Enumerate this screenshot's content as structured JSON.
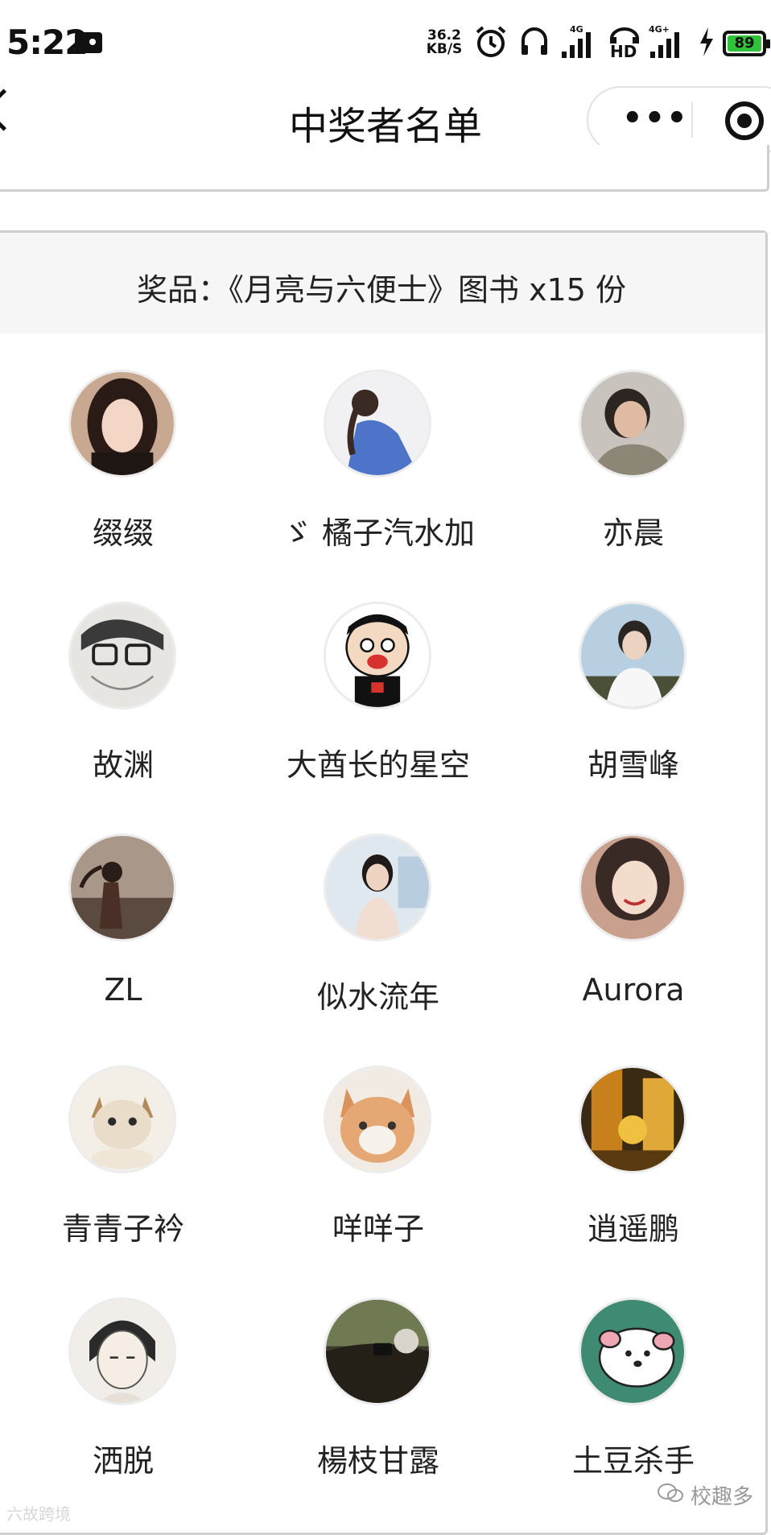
{
  "status_bar": {
    "time": "5:22",
    "net_speed_value": "36.2",
    "net_speed_unit": "KB/S",
    "net_4g": "4G",
    "net_4g_plus": "4G+",
    "hd": "HD",
    "battery": "89",
    "icons": [
      "image-notification-icon",
      "alarm-icon",
      "headphones-icon",
      "signal-icon",
      "hd-call-icon",
      "signal-icon",
      "charging-icon",
      "battery-icon"
    ]
  },
  "nav": {
    "title": "中奖者名单",
    "back_icon": "chevron-left-icon",
    "more_icon": "more-dots-icon",
    "close_icon": "target-close-icon"
  },
  "prize": {
    "label": "奖品：《月亮与六便士》图书 x15 份"
  },
  "winners": [
    {
      "name": "缀缀",
      "avatar": "avatar-girl-portrait"
    },
    {
      "name": "ゞ 橘子汽水加",
      "avatar": "avatar-girl-blue-jacket"
    },
    {
      "name": "亦晨",
      "avatar": "avatar-boy-on-phone"
    },
    {
      "name": "故渊",
      "avatar": "avatar-anime-glasses"
    },
    {
      "name": "大酋长的星空",
      "avatar": "avatar-cartoon-hug-boy"
    },
    {
      "name": "胡雪峰",
      "avatar": "avatar-boy-white-shirt"
    },
    {
      "name": "ZL",
      "avatar": "avatar-girl-windy"
    },
    {
      "name": "似水流年",
      "avatar": "avatar-girl-outdoor"
    },
    {
      "name": "Aurora",
      "avatar": "avatar-smiling-girl"
    },
    {
      "name": "青青子衿",
      "avatar": "avatar-kitten"
    },
    {
      "name": "咩咩子",
      "avatar": "avatar-drawn-cat"
    },
    {
      "name": "逍遥鹏",
      "avatar": "avatar-street-night"
    },
    {
      "name": "洒脱",
      "avatar": "avatar-anime-boy"
    },
    {
      "name": "楊枝甘露",
      "avatar": "avatar-car-photo"
    },
    {
      "name": "土豆杀手",
      "avatar": "avatar-white-dog"
    }
  ],
  "watermark_left": "六故跨境",
  "watermark_right": "校趣多",
  "colors": {
    "battery": "#2fc23a",
    "prize_band": "#f6f6f6",
    "avatar_border": "#ececec"
  }
}
